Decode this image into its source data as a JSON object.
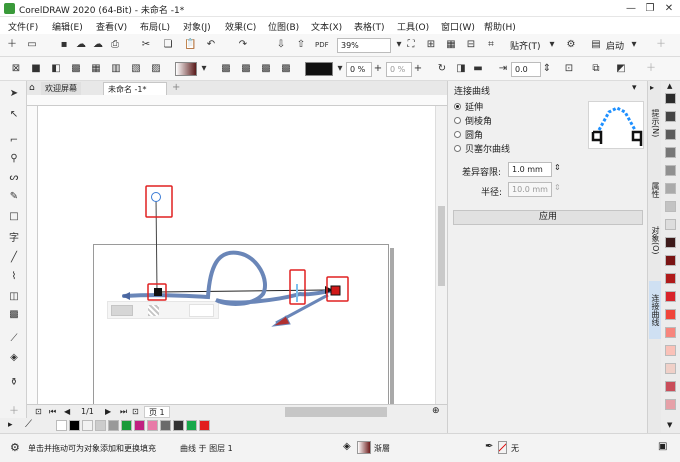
{
  "window": {
    "title": "CorelDRAW 2020 (64-Bit) - 未命名 -1*",
    "controls": [
      "minimize",
      "restore",
      "close"
    ]
  },
  "menu": [
    "文件(F)",
    "编辑(E)",
    "查看(V)",
    "布局(L)",
    "对象(J)",
    "效果(C)",
    "位图(B)",
    "文本(X)",
    "表格(T)",
    "工具(O)",
    "窗口(W)",
    "帮助(H)"
  ],
  "standard_toolbar": {
    "zoom_value": "39%",
    "snap_label": "贴齐(T)",
    "launch_label": "启动"
  },
  "property_bar": {
    "transparency_1": "0 %",
    "transparency_2": "0 %",
    "offset_value": "0.0"
  },
  "doc_tabs": [
    {
      "label": "欢迎屏幕",
      "active": false
    },
    {
      "label": "未命名 -1*",
      "active": true
    }
  ],
  "page_nav": {
    "page_label": "页 1"
  },
  "status": {
    "hint": "单击并拖动可为对象添加和更换填充",
    "object_info": "曲线 于 图层 1",
    "fill_label": "渐層",
    "outline_label": "无"
  },
  "docker": {
    "title": "连接曲线",
    "options": [
      {
        "label": "延伸",
        "selected": true
      },
      {
        "label": "倒棱角",
        "selected": false
      },
      {
        "label": "圆角",
        "selected": false
      },
      {
        "label": "贝塞尔曲线",
        "selected": false
      }
    ],
    "tolerance_label": "差异容限:",
    "tolerance_value": "1.0 mm",
    "radius_label": "半径:",
    "radius_value": "10.0 mm",
    "apply_label": "应用"
  },
  "side_tabs": [
    "提示(N)",
    "属性",
    "对象(O)",
    "连接曲线"
  ],
  "colors": {
    "accent_red": "#e02020",
    "curve_blue": "#6a86b8",
    "docker_preview_blue": "#1e90ff"
  },
  "palette_bottom": [
    "#ffffff",
    "#000000",
    "#f2f2f2",
    "#cccccc",
    "#999999",
    "#1a9a3a",
    "#c02080",
    "#e87aa8",
    "#6a6a6a",
    "#333333",
    "#17a84a",
    "#e11d1d"
  ],
  "palette_right": [
    "#2b2b2b",
    "#444444",
    "#5c5c5c",
    "#777777",
    "#909090",
    "#aaaaaa",
    "#c3c3c3",
    "#dddddd",
    "#3d1a1a",
    "#7a1414",
    "#b01b1b",
    "#d8232a",
    "#f0453a",
    "#f7857d",
    "#fac1b8",
    "#f0d0c8",
    "#c94d5a",
    "#e6a1a8"
  ]
}
